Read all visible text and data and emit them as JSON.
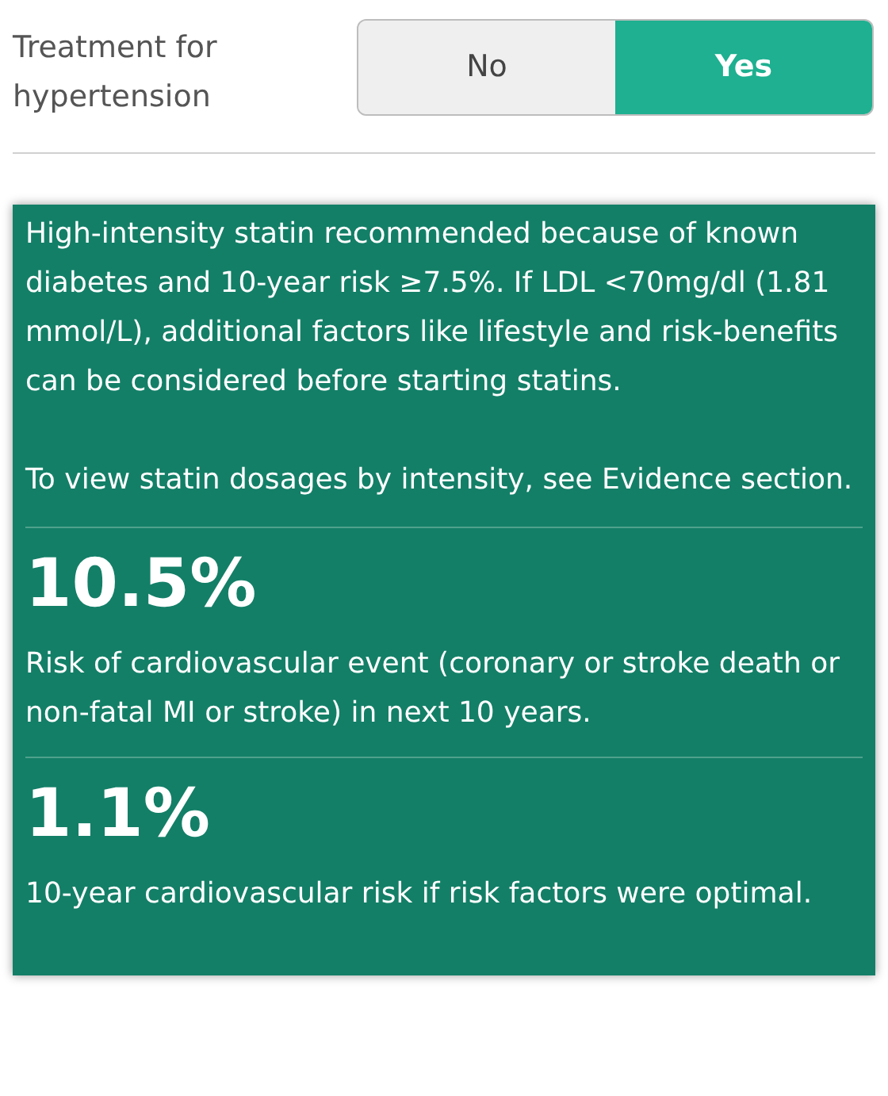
{
  "question": {
    "label": "Treatment for hypertension",
    "options": [
      {
        "label": "No",
        "selected": false
      },
      {
        "label": "Yes",
        "selected": true
      }
    ]
  },
  "result": {
    "recommendation": [
      "High-intensity statin recommended because of known diabetes and 10-year risk ≥7.5%. If LDL <70mg/dl (1.81 mmol/L), additional factors like lifestyle and risk-benefits can be considered before starting statins.",
      "To view statin dosages by intensity, see Evidence section."
    ],
    "scores": [
      {
        "value": "10.5%",
        "description": "Risk of cardiovascular event (coronary or stroke death or non-fatal MI or stroke) in next 10 years."
      },
      {
        "value": "1.1%",
        "description": "10-year cardiovascular risk if risk factors were optimal."
      }
    ]
  }
}
